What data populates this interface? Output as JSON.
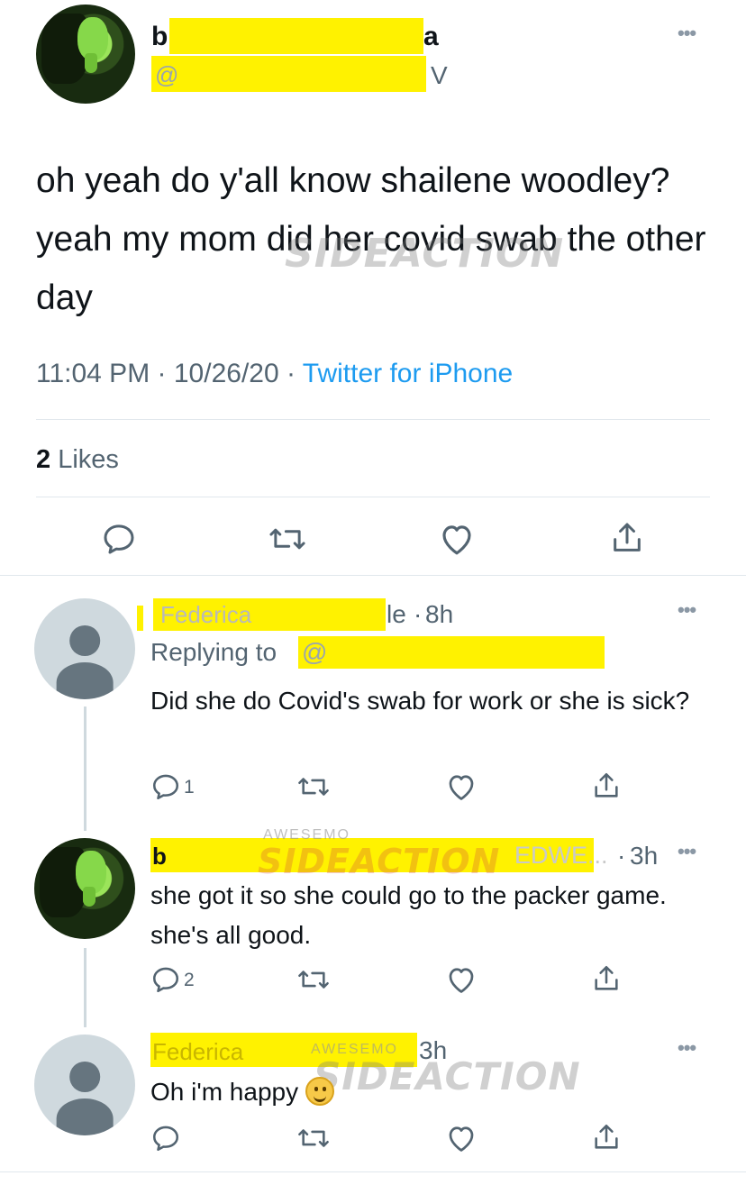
{
  "main_tweet": {
    "display_name_start": "b",
    "display_name_end": "a",
    "handle_start": "@",
    "handle_end": "V",
    "more_label": "•••",
    "text": "oh yeah do y'all know shailene woodley? yeah my mom did her covid swab the other day",
    "time": "11:04 PM",
    "date": "10/26/20",
    "source": "Twitter for iPhone",
    "separator": "·",
    "likes_count": "2",
    "likes_label": "Likes"
  },
  "replies": [
    {
      "name_visible": "Federica",
      "name_tail": "le",
      "time": "8h",
      "replying_to_label": "Replying to",
      "replying_to_handle": "@",
      "text": "Did she do Covid's swab for work or she is sick?",
      "reply_count": "1"
    },
    {
      "name_visible": "b",
      "handle_tail": "EDWE...",
      "time": "3h",
      "text": "she got it so she could go to the packer game. she's all good.",
      "reply_count": "2"
    },
    {
      "name_visible": "Federica",
      "time": "3h",
      "text": "Oh i'm happy"
    }
  ],
  "watermark": {
    "brand": "SIDEACTION",
    "small": "AWESEMO"
  },
  "icons": {
    "reply": "reply-icon",
    "retweet": "retweet-icon",
    "like": "heart-icon",
    "share": "share-icon",
    "more": "more-icon"
  },
  "colors": {
    "highlight": "#fff200",
    "link": "#1d9bf0",
    "secondary_text": "#536471",
    "divider": "#e1e8ed"
  }
}
